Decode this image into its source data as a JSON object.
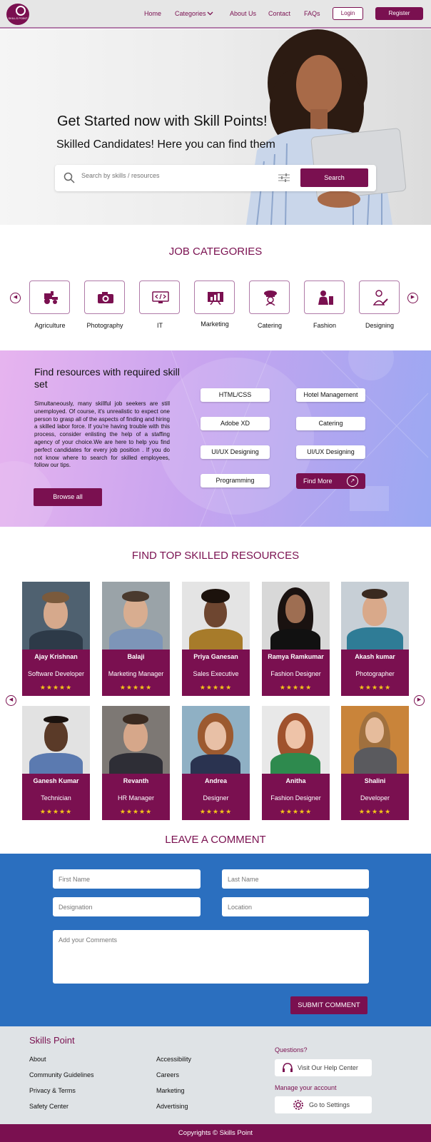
{
  "header": {
    "logo_text": "SKILLS POINT",
    "nav": [
      "Home",
      "Categories",
      "About Us",
      "Contact",
      "FAQs"
    ],
    "login": "Login",
    "register": "Register"
  },
  "hero": {
    "title": "Get Started now with Skill Points!",
    "subtitle": "Skilled Candidates! Here you can find them",
    "search_placeholder": "Search by skills / resources",
    "search_button": "Search"
  },
  "categories": {
    "title": "JOB CATEGORIES",
    "items": [
      {
        "label": "Agriculture",
        "icon": "tractor-icon"
      },
      {
        "label": "Photography",
        "icon": "camera-icon"
      },
      {
        "label": "IT",
        "icon": "monitor-code-icon"
      },
      {
        "label": "Marketing",
        "icon": "chart-board-icon"
      },
      {
        "label": "Catering",
        "icon": "chef-icon"
      },
      {
        "label": "Fashion",
        "icon": "fashion-icon"
      },
      {
        "label": "Designing",
        "icon": "designer-icon"
      }
    ]
  },
  "resources": {
    "title": "Find resources with required skill set",
    "body": "Simultaneously, many skillful job seekers are still unemployed. Of course, it's unrealistic to expect one person to grasp all of the aspects of finding and hiring a skilled labor force. If you're having trouble with this process, consider enlisting the help of a staffing agency of your choice.We are here to help you find perfect candidates for every job position . If you do not know where to search for skilled employees, follow our tips.",
    "browse": "Browse all",
    "skills_left": [
      "HTML/CSS",
      "Adobe XD",
      "UI/UX Designing",
      "Programming"
    ],
    "skills_right": [
      "Hotel Management",
      "Catering",
      "UI/UX Designing"
    ],
    "find_more": "Find More"
  },
  "top": {
    "title": "FIND TOP SKILLED RESOURCES",
    "people": [
      {
        "name": "Ajay Krishnan",
        "role": "Software Developer",
        "stars": "★★★★★"
      },
      {
        "name": "Balaji",
        "role": "Marketing Manager",
        "stars": "★★★★★"
      },
      {
        "name": "Priya Ganesan",
        "role": "Sales Executive",
        "stars": "★★★★★"
      },
      {
        "name": "Ramya Ramkumar",
        "role": "Fashion Designer",
        "stars": "★★★★★"
      },
      {
        "name": "Akash kumar",
        "role": "Photographer",
        "stars": "★★★★★"
      },
      {
        "name": "Ganesh Kumar",
        "role": "Technician",
        "stars": "★★★★★"
      },
      {
        "name": "Revanth",
        "role": "HR Manager",
        "stars": "★★★★★"
      },
      {
        "name": "Andrea",
        "role": "Designer",
        "stars": "★★★★★"
      },
      {
        "name": "Anitha",
        "role": "Fashion Designer",
        "stars": "★★★★★"
      },
      {
        "name": "Shalini",
        "role": "Developer",
        "stars": "★★★★★"
      }
    ]
  },
  "comment": {
    "title": "LEAVE A COMMENT",
    "first_name": "First Name",
    "last_name": "Last Name",
    "designation": "Designation",
    "location": "Location",
    "comments": "Add your Comments",
    "submit": "SUBMIT COMMENT"
  },
  "footer": {
    "brand": "Skills Point",
    "col1": [
      "About",
      "Community Guidelines",
      "Privacy & Terms",
      "Safety Center"
    ],
    "col2": [
      "Accessibility",
      "Careers",
      "Marketing",
      "Advertising"
    ],
    "questions": "Questions?",
    "help": "Visit Our Help Center",
    "manage": "Manage your account",
    "settings": "Go to Settings",
    "copyright": "Copyrights © Skills Point"
  },
  "colors": {
    "brand": "#7a1050",
    "form_bg": "#2b6fbf",
    "star": "#f5c518"
  }
}
